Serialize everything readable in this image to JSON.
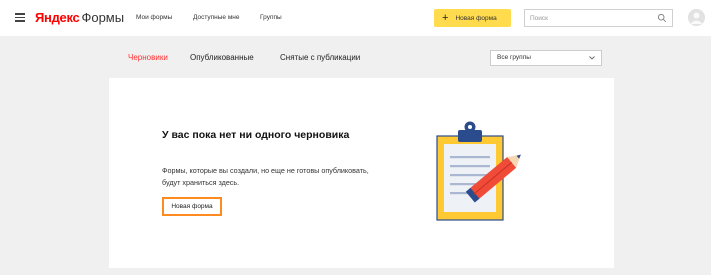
{
  "header": {
    "logo_brand": "Яндекс",
    "logo_product": "Формы",
    "nav": [
      {
        "label": "Мои формы"
      },
      {
        "label": "Доступные мне"
      },
      {
        "label": "Группы"
      }
    ],
    "new_form_button": "Новая форма",
    "search_placeholder": "Поиск"
  },
  "tabs": [
    {
      "label": "Черновики",
      "active": true
    },
    {
      "label": "Опубликованные",
      "active": false
    },
    {
      "label": "Снятые с публикации",
      "active": false
    }
  ],
  "group_select": {
    "value": "Все группы"
  },
  "empty_state": {
    "title": "У вас пока нет ни одного черновика",
    "description": "Формы, которые вы создали, но еще не готовы опубликовать, будут храниться здесь.",
    "button": "Новая форма"
  },
  "colors": {
    "brand_red": "#ff0000",
    "accent_yellow": "#ffdb4d",
    "active_tab": "#ff3333",
    "highlight_orange": "#ff8a1f",
    "illustration_yellow": "#ffc933",
    "illustration_red": "#f04a38",
    "illustration_blue": "#2b4c8c"
  },
  "icons": [
    "menu-icon",
    "plus-icon",
    "search-icon",
    "user-avatar-icon",
    "chevron-down-icon",
    "clipboard-illustration"
  ]
}
